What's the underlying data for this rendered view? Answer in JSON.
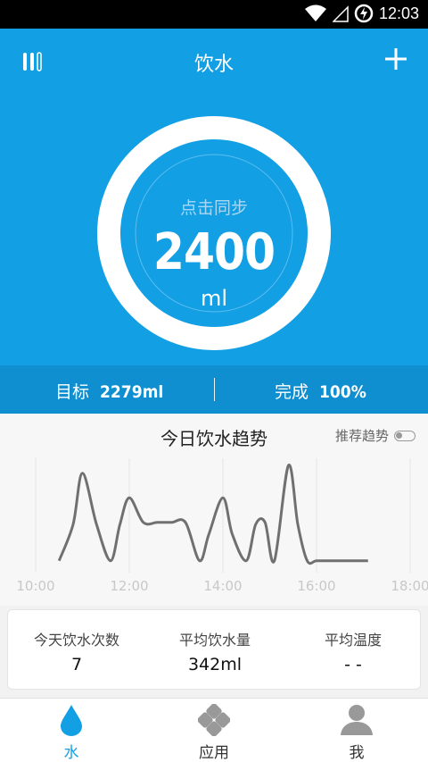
{
  "status_bar": {
    "time": "12:03"
  },
  "header": {
    "title": "饮水"
  },
  "ring": {
    "hint": "点击同步",
    "value": "2400",
    "unit": "ml"
  },
  "pager": {
    "count": 2,
    "active": 0
  },
  "summary": {
    "target_label": "目标",
    "target_value": "2279ml",
    "done_label": "完成",
    "done_value": "100%"
  },
  "trend": {
    "title": "今日饮水趋势",
    "toggle_label": "推荐趋势",
    "toggle_on": false
  },
  "chart_data": {
    "type": "line",
    "x_tick_labels": [
      "10:00",
      "12:00",
      "14:00",
      "16:00",
      "18:00"
    ],
    "xlim": [
      10,
      18
    ],
    "x": [
      10.5,
      10.8,
      11.0,
      11.3,
      11.6,
      11.8,
      12.0,
      12.3,
      12.6,
      12.9,
      13.2,
      13.5,
      13.7,
      14.0,
      14.2,
      14.5,
      14.7,
      14.9,
      15.1,
      15.4,
      15.6,
      15.8,
      16.0,
      16.3,
      16.6,
      16.9,
      17.1
    ],
    "y": [
      0.03,
      0.4,
      0.92,
      0.4,
      0.03,
      0.4,
      0.67,
      0.42,
      0.42,
      0.42,
      0.42,
      0.03,
      0.3,
      0.67,
      0.3,
      0.03,
      0.4,
      0.42,
      0.03,
      1.0,
      0.4,
      0.03,
      0.03,
      0.03,
      0.03,
      0.03,
      0.03
    ],
    "ylim": [
      0,
      1
    ],
    "grid": true,
    "color": "#707070"
  },
  "stats": [
    {
      "label": "今天饮水次数",
      "value": "7"
    },
    {
      "label": "平均饮水量",
      "value": "342ml"
    },
    {
      "label": "平均温度",
      "value": "- -"
    }
  ],
  "tabs": [
    {
      "label": "水",
      "icon": "water-drop-icon",
      "active": true
    },
    {
      "label": "应用",
      "icon": "apps-icon",
      "active": false
    },
    {
      "label": "我",
      "icon": "profile-icon",
      "active": false
    }
  ],
  "colors": {
    "primary": "#129fe3",
    "primary_dark": "#0f8fd0",
    "active_tab": "#129fe3",
    "inactive_tab": "#999999"
  }
}
